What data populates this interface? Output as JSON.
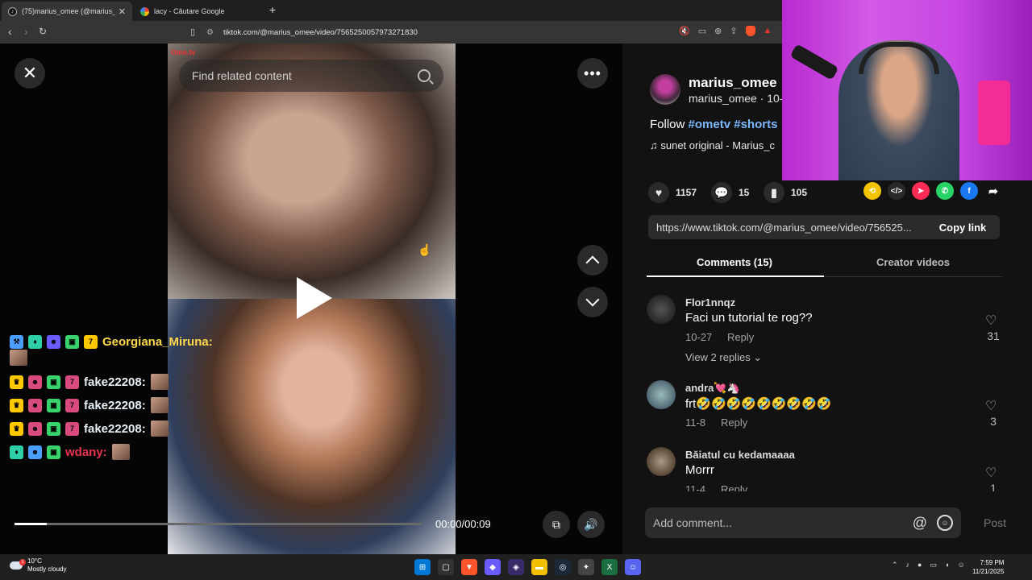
{
  "browser": {
    "tabs": [
      {
        "title": "(75)marius_omee (@marius_ome",
        "active": true
      },
      {
        "title": "lacy - Căutare Google",
        "active": false
      }
    ],
    "new_tab": "+",
    "url": "tiktok.com/@marius_omee/video/7565250057973271830"
  },
  "video": {
    "watermark": "Ome.tv",
    "search_placeholder": "Find related content",
    "time": "00:00/00:09",
    "progress": 0.08
  },
  "chat": [
    {
      "user": "Georgiana_Miruna:",
      "badges": [
        "blue",
        "teal",
        "purple",
        "green",
        "gold"
      ],
      "emote": true
    },
    {
      "user": "fake22208:",
      "badges": [
        "gold",
        "pink",
        "green",
        "pink"
      ],
      "emote": true
    },
    {
      "user": "fake22208:",
      "badges": [
        "gold",
        "pink",
        "green",
        "pink"
      ],
      "emote": true
    },
    {
      "user": "fake22208:",
      "badges": [
        "gold",
        "pink",
        "green",
        "pink"
      ],
      "emote": true
    },
    {
      "user": "wdany:",
      "badges": [
        "teal",
        "blue",
        "green"
      ],
      "emote": true
    }
  ],
  "post": {
    "author_name": "marius_omee",
    "author_meta": "marius_omee · 10-2",
    "caption_prefix": "Follow",
    "tag1": "#ometv",
    "tag2": "#shorts",
    "music": "♫  sunet original - Marius_c",
    "likes": "1157",
    "comments": "15",
    "saves": "105",
    "link": "https://www.tiktok.com/@marius_omee/video/756525...",
    "copy_label": "Copy link"
  },
  "tabs": {
    "comments": "Comments (15)",
    "creator": "Creator videos"
  },
  "comments": [
    {
      "user": "Flor1nnqz",
      "text": "Faci un tutorial te rog??",
      "date": "10-27",
      "reply": "Reply",
      "likes": "31",
      "replies": "View 2 replies ⌄"
    },
    {
      "user": "andra💘🦄",
      "text": "frt🤣🤣🤣🤣🤣🤣🤣🤣🤣",
      "date": "11-8",
      "reply": "Reply",
      "likes": "3"
    },
    {
      "user": "Băiatul cu kedamaaaa",
      "text": "Morrr",
      "date": "11-4",
      "reply": "Reply",
      "likes": "1"
    }
  ],
  "comment_input": {
    "placeholder": "Add comment...",
    "at": "@",
    "post": "Post"
  },
  "taskbar": {
    "temp": "10°C",
    "weather": "Mostly cloudy",
    "notif": "1",
    "time": "7:59 PM",
    "date": "11/21/2025"
  },
  "colors": {
    "hashtag": "#7ab8ff",
    "georgiana": "#ffd84a",
    "wdany": "#e8334e",
    "webcam_bg": "#c747e3"
  }
}
